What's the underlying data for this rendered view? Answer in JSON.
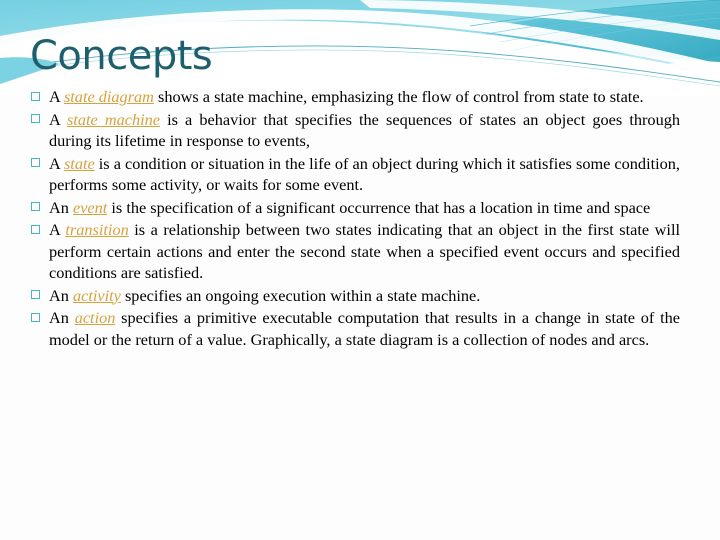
{
  "slide": {
    "title": "Concepts",
    "theme": {
      "title_color": "#1d5f6e",
      "bullet_marker_color": "#49b6c4",
      "term_color": "#d6a23d",
      "body_text_color": "#000000",
      "background_color": "#fdfdfd",
      "header_cyan": "#7fd3e3",
      "header_teal": "#2aa6bd",
      "header_white": "#ffffff"
    },
    "bullets": [
      {
        "marker": "hollow-square-bullet",
        "term": "state diagram",
        "lead": "A ",
        "rest": " shows a state machine, emphasizing the flow of control from state to state."
      },
      {
        "marker": "hollow-square-bullet",
        "term": "state machine",
        "lead": "A ",
        "rest": " is a behavior that specifies the sequences of states an object goes through during its lifetime in response to events,"
      },
      {
        "marker": "hollow-square-bullet",
        "term": "state",
        "lead": "A ",
        "rest": " is a condition or situation in the life of an object during which it satisfies some condition, performs some activity, or waits for some event."
      },
      {
        "marker": "hollow-square-bullet",
        "term": "event",
        "lead": "An ",
        "rest": " is the specification of a significant occurrence that has a location in time and space"
      },
      {
        "marker": "hollow-square-bullet",
        "term": "transition",
        "lead": "A ",
        "rest": " is a relationship between two states indicating that an object in the first state will perform certain actions and enter the second state when a specified event occurs and specified conditions are satisfied."
      },
      {
        "marker": "hollow-square-bullet",
        "term": "activity",
        "lead": "An ",
        "rest": " specifies an ongoing execution within a state machine."
      },
      {
        "marker": "hollow-square-bullet",
        "term": "action",
        "lead": "An ",
        "rest": " specifies a primitive executable computation that results in a change in state of the model or the return of a value. Graphically, a state diagram is a collection of nodes and arcs."
      }
    ]
  }
}
